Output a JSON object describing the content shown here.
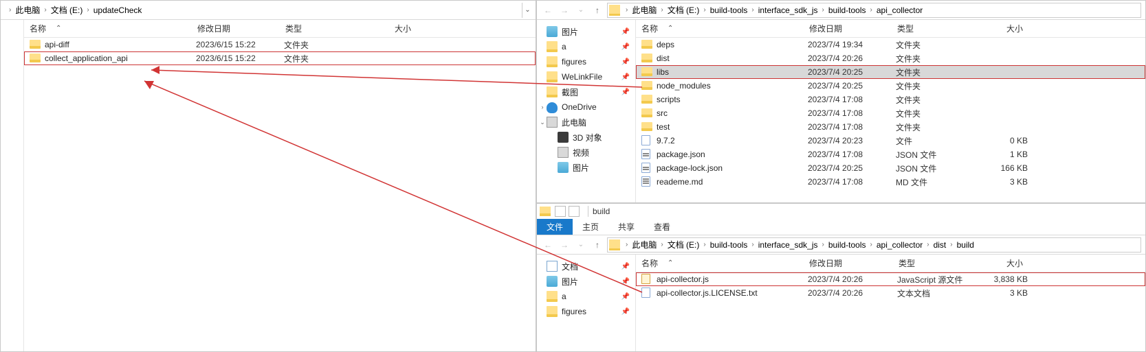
{
  "left": {
    "breadcrumbs": [
      "此电脑",
      "文档 (E:)",
      "updateCheck"
    ],
    "columns": {
      "name": "名称",
      "date": "修改日期",
      "type": "类型",
      "size": "大小"
    },
    "rows": [
      {
        "name": "api-diff",
        "date": "2023/6/15 15:22",
        "type": "文件夹",
        "size": "",
        "icon": "folder"
      },
      {
        "name": "collect_application_api",
        "date": "2023/6/15 15:22",
        "type": "文件夹",
        "size": "",
        "icon": "folder",
        "highlight": true
      }
    ]
  },
  "topRight": {
    "breadcrumbs": [
      "此电脑",
      "文档 (E:)",
      "build-tools",
      "interface_sdk_js",
      "build-tools",
      "api_collector"
    ],
    "columns": {
      "name": "名称",
      "date": "修改日期",
      "type": "类型",
      "size": "大小"
    },
    "tree": [
      {
        "label": "图片",
        "icon": "pictures",
        "pinned": true
      },
      {
        "label": "a",
        "icon": "folder",
        "pinned": true
      },
      {
        "label": "figures",
        "icon": "folder",
        "pinned": true
      },
      {
        "label": "WeLinkFile",
        "icon": "folder",
        "pinned": true
      },
      {
        "label": "截图",
        "icon": "folder",
        "pinned": true
      },
      {
        "label": "OneDrive",
        "icon": "onedrive",
        "expander": ">"
      },
      {
        "label": "此电脑",
        "icon": "pc",
        "expander": "v"
      },
      {
        "label": "3D 对象",
        "icon": "3d",
        "l2": true
      },
      {
        "label": "视频",
        "icon": "video",
        "l2": true
      },
      {
        "label": "图片",
        "icon": "pictures",
        "l2": true
      }
    ],
    "rows": [
      {
        "name": "deps",
        "date": "2023/7/4 19:34",
        "type": "文件夹",
        "size": "",
        "icon": "folder"
      },
      {
        "name": "dist",
        "date": "2023/7/4 20:26",
        "type": "文件夹",
        "size": "",
        "icon": "folder"
      },
      {
        "name": "libs",
        "date": "2023/7/4 20:25",
        "type": "文件夹",
        "size": "",
        "icon": "folder",
        "highlight": true,
        "selected": true
      },
      {
        "name": "node_modules",
        "date": "2023/7/4 20:25",
        "type": "文件夹",
        "size": "",
        "icon": "folder"
      },
      {
        "name": "scripts",
        "date": "2023/7/4 17:08",
        "type": "文件夹",
        "size": "",
        "icon": "folder"
      },
      {
        "name": "src",
        "date": "2023/7/4 17:08",
        "type": "文件夹",
        "size": "",
        "icon": "folder"
      },
      {
        "name": "test",
        "date": "2023/7/4 17:08",
        "type": "文件夹",
        "size": "",
        "icon": "folder"
      },
      {
        "name": "9.7.2",
        "date": "2023/7/4 20:23",
        "type": "文件",
        "size": "0 KB",
        "icon": "file"
      },
      {
        "name": "package.json",
        "date": "2023/7/4 17:08",
        "type": "JSON 文件",
        "size": "1 KB",
        "icon": "json"
      },
      {
        "name": "package-lock.json",
        "date": "2023/7/4 20:25",
        "type": "JSON 文件",
        "size": "166 KB",
        "icon": "json"
      },
      {
        "name": "reademe.md",
        "date": "2023/7/4 17:08",
        "type": "MD 文件",
        "size": "3 KB",
        "icon": "md"
      }
    ]
  },
  "bottomRight": {
    "windowTitle": "build",
    "ribbonTabs": [
      "文件",
      "主页",
      "共享",
      "查看"
    ],
    "breadcrumbs": [
      "此电脑",
      "文档 (E:)",
      "build-tools",
      "interface_sdk_js",
      "build-tools",
      "api_collector",
      "dist",
      "build"
    ],
    "columns": {
      "name": "名称",
      "date": "修改日期",
      "type": "类型",
      "size": "大小"
    },
    "tree": [
      {
        "label": "文档",
        "icon": "docs",
        "pinned": true
      },
      {
        "label": "图片",
        "icon": "pictures",
        "pinned": true
      },
      {
        "label": "a",
        "icon": "folder",
        "pinned": true
      },
      {
        "label": "figures",
        "icon": "folder",
        "pinned": true
      }
    ],
    "rows": [
      {
        "name": "api-collector.js",
        "date": "2023/7/4 20:26",
        "type": "JavaScript 源文件",
        "size": "3,838 KB",
        "icon": "js",
        "highlight": true
      },
      {
        "name": "api-collector.js.LICENSE.txt",
        "date": "2023/7/4 20:26",
        "type": "文本文档",
        "size": "3 KB",
        "icon": "file"
      }
    ]
  }
}
